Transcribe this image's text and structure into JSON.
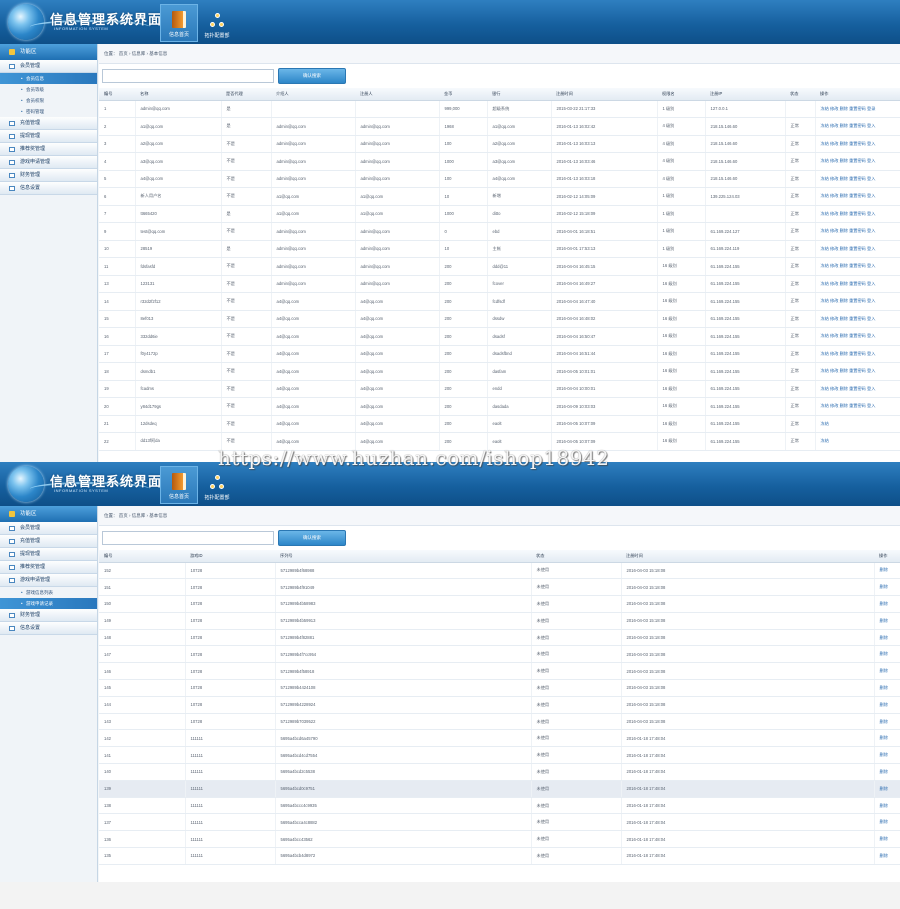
{
  "app": {
    "title": "信息管理系统界面",
    "subtitle": "INFORMATION SYSTEM"
  },
  "top_nav": [
    {
      "label": "信息首页",
      "icon": "book-icon"
    },
    {
      "label": "拓扑配置部"
    }
  ],
  "colors": {
    "header": "#16609f",
    "accent": "#2d86c8",
    "sidebar_active": "#3f95d6",
    "row_highlight": "#e6ebf2"
  },
  "panel1": {
    "sidebar": {
      "head": "功能区",
      "items": [
        {
          "type": "group",
          "label": "会员管理"
        },
        {
          "type": "sub",
          "label": "会员信息",
          "active": true
        },
        {
          "type": "sub",
          "label": "会员等级"
        },
        {
          "type": "sub",
          "label": "会员权限"
        },
        {
          "type": "sub",
          "label": "密码管理"
        },
        {
          "type": "group",
          "label": "充值管理"
        },
        {
          "type": "group",
          "label": "提现管理"
        },
        {
          "type": "group",
          "label": "推荐奖管理"
        },
        {
          "type": "group",
          "label": "游戏申请管理"
        },
        {
          "type": "group",
          "label": "财务管理"
        },
        {
          "type": "group",
          "label": "信息设置"
        }
      ]
    },
    "breadcrumb": "位置： 首页 › 信息库 › 基本信息",
    "search": {
      "placeholder": "",
      "button": "确认搜索"
    },
    "columns": [
      "编号",
      "名称",
      "是否代理",
      "介绍人",
      "注册人",
      "金币",
      "银行",
      "注册时间",
      "权限名",
      "注册IP",
      "状态",
      "操作"
    ],
    "col_widths": [
      36,
      86,
      50,
      84,
      84,
      48,
      64,
      106,
      48,
      80,
      30,
      90
    ],
    "rows": [
      [
        "1",
        "admin@qq.com",
        "是",
        "",
        "",
        "999,000",
        "超级系统",
        "2015-03-22 21:17:33",
        "1 级别",
        "127.0.0.1",
        "",
        "冻结 修改 删除 重置密码 登录"
      ],
      [
        "2",
        "a1@qq.com",
        "是",
        "admin@qq.com",
        "admin@qq.com",
        "1968",
        "a1@qq.com",
        "2016-01-13 16:02:42",
        "4 级别",
        "218.15.146.60",
        "正常",
        "冻结 修改 删除 重置密码 登入"
      ],
      [
        "3",
        "a2@qq.com",
        "不是",
        "admin@qq.com",
        "admin@qq.com",
        "100",
        "a2@qq.com",
        "2016-01-13 16:03:13",
        "4 级别",
        "218.15.146.60",
        "正常",
        "冻结 修改 删除 重置密码 登入"
      ],
      [
        "4",
        "a3@qq.com",
        "不是",
        "admin@qq.com",
        "admin@qq.com",
        "1000",
        "a3@qq.com",
        "2016-01-13 16:03:46",
        "4 级别",
        "218.15.146.60",
        "正常",
        "冻结 修改 删除 重置密码 登入"
      ],
      [
        "5",
        "a4@qq.com",
        "不是",
        "admin@qq.com",
        "admin@qq.com",
        "100",
        "a4@qq.com",
        "2016-01-13 16:03:18",
        "4 级别",
        "218.15.146.60",
        "正常",
        "冻结 修改 删除 重置密码 登入"
      ],
      [
        "6",
        "新人用户名",
        "不是",
        "a1@qq.com",
        "a1@qq.com",
        "10",
        "新增",
        "2016-02-12 14:05:09",
        "1 级别",
        "139.225.124.03",
        "正常",
        "冻结 修改 删除 重置密码 登入"
      ],
      [
        "7",
        "tt665420",
        "是",
        "a1@qq.com",
        "a1@qq.com",
        "1000",
        "ditto",
        "2016-02-12 15:18:09",
        "1 级别",
        "",
        "正常",
        "冻结 修改 删除 重置密码 登入"
      ],
      [
        "9",
        "test@qq.com",
        "不是",
        "admin@qq.com",
        "admin@qq.com",
        "0",
        "ebd",
        "2016-04-01 16:18:51",
        "1 级别",
        "61.169.224.127",
        "正常",
        "冻结 修改 删除 重置密码 登入"
      ],
      [
        "10",
        "28519",
        "是",
        "admin@qq.com",
        "admin@qq.com",
        "10",
        "主帐",
        "2016-04-01 17:53:13",
        "1 级别",
        "61.169.224.119",
        "正常",
        "冻结 修改 删除 重置密码 登入"
      ],
      [
        "11",
        "fdsfasfd",
        "不是",
        "admin@qq.com",
        "admin@qq.com",
        "200",
        "ddd@11",
        "2016-04-04 16:45:15",
        "16 级别",
        "61.169.224.155",
        "正常",
        "冻结 修改 删除 重置密码 登入"
      ],
      [
        "13",
        "123131",
        "不是",
        "admin@qq.com",
        "admin@qq.com",
        "200",
        "fcover",
        "2016-04-04 16:49:27",
        "16 级别",
        "61.169.224.155",
        "正常",
        "冻结 修改 删除 重置密码 登入"
      ],
      [
        "14",
        "r32d2f2f12",
        "不是",
        "a4@qq.com",
        "a4@qq.com",
        "200",
        "fcdfsdf",
        "2016-04-04 16:47:40",
        "16 级别",
        "61.169.224.155",
        "正常",
        "冻结 修改 删除 重置密码 登入"
      ],
      [
        "15",
        "8ef013",
        "不是",
        "a4@qq.com",
        "a4@qq.com",
        "200",
        "dssdw",
        "2016-04-04 16:48:02",
        "16 级别",
        "61.169.224.155",
        "正常",
        "冻结 修改 删除 重置密码 登入"
      ],
      [
        "16",
        "332dd6ie",
        "不是",
        "a4@qq.com",
        "a4@qq.com",
        "200",
        "dsadsf",
        "2016-04-04 16:50:47",
        "16 级别",
        "61.169.224.155",
        "正常",
        "冻结 修改 删除 重置密码 登入"
      ],
      [
        "17",
        "f0y4172p",
        "不是",
        "a4@qq.com",
        "a4@qq.com",
        "200",
        "dsadsfbnd",
        "2016-04-04 16:51:44",
        "16 级别",
        "61.169.224.155",
        "正常",
        "冻结 修改 删除 重置密码 登入"
      ],
      [
        "18",
        "dsmdb1",
        "不是",
        "a4@qq.com",
        "a4@qq.com",
        "200",
        "dasfam",
        "2016-04-05 10:01:01",
        "16 级别",
        "61.169.224.155",
        "正常",
        "冻结 修改 删除 重置密码 登入"
      ],
      [
        "19",
        "fcadms",
        "不是",
        "a4@qq.com",
        "a4@qq.com",
        "200",
        "endd",
        "2016-04-04 10:00:01",
        "16 级别",
        "61.169.224.155",
        "正常",
        "冻结 修改 删除 重置密码 登入"
      ],
      [
        "20",
        "y84d179gs",
        "不是",
        "a4@qq.com",
        "a4@qq.com",
        "200",
        "dasdada",
        "2016-04-09 10:03:03",
        "16 级别",
        "61.169.224.155",
        "正常",
        "冻结 修改 删除 重置密码 登入"
      ],
      [
        "21",
        "12dsdeq",
        "不是",
        "a4@qq.com",
        "a4@qq.com",
        "200",
        "eaolt",
        "2016-04-05 10:07:09",
        "16 级别",
        "61.169.224.155",
        "正常",
        "冻结"
      ],
      [
        "22",
        "dd13f阿da",
        "不是",
        "a4@qq.com",
        "a4@qq.com",
        "200",
        "eaolt",
        "2016-04-05 10:07:09",
        "16 级别",
        "61.169.224.155",
        "正常",
        "冻结"
      ]
    ]
  },
  "panel2": {
    "sidebar": {
      "head": "功能区",
      "items": [
        {
          "type": "group",
          "label": "会员管理"
        },
        {
          "type": "group",
          "label": "充值管理"
        },
        {
          "type": "group",
          "label": "提现管理"
        },
        {
          "type": "group",
          "label": "推荐奖管理"
        },
        {
          "type": "group",
          "label": "游戏申请管理"
        },
        {
          "type": "sub",
          "label": "游戏信息列表"
        },
        {
          "type": "sub",
          "label": "游戏申请记录",
          "active": true
        },
        {
          "type": "group",
          "label": "财务管理"
        },
        {
          "type": "group",
          "label": "信息设置"
        }
      ]
    },
    "breadcrumb": "位置： 首页 › 信息库 › 基本信息",
    "search": {
      "placeholder": "",
      "button": "确认搜索"
    },
    "columns": [
      "编号",
      "游戏ID",
      "序列号",
      "状态",
      "注册时间",
      "操作"
    ],
    "col_widths": [
      86,
      90,
      256,
      90,
      253,
      26
    ],
    "rows": [
      [
        "152",
        "10728",
        "5712989b4f68988",
        "未使用",
        "2016-04-03 15:18:08",
        "删除"
      ],
      [
        "151",
        "10728",
        "5712989b4f91049",
        "未使用",
        "2016-04-03 15:18:08",
        "删除"
      ],
      [
        "150",
        "10728",
        "5712989b4b58983",
        "未使用",
        "2016-04-03 15:18:08",
        "删除"
      ],
      [
        "149",
        "10728",
        "5712989b4b59913",
        "未使用",
        "2016-04-03 15:18:08",
        "删除"
      ],
      [
        "148",
        "10728",
        "5712989b4f82881",
        "未使用",
        "2016-04-03 15:18:08",
        "删除"
      ],
      [
        "147",
        "10728",
        "5712989b4f7cc954",
        "未使用",
        "2016-04-03 15:18:08",
        "删除"
      ],
      [
        "146",
        "10728",
        "5712989b4f58918",
        "未使用",
        "2016-04-03 15:18:08",
        "删除"
      ],
      [
        "145",
        "10728",
        "5712989b4424108",
        "未使用",
        "2016-04-03 15:18:08",
        "删除"
      ],
      [
        "144",
        "10728",
        "5712989b4228924",
        "未使用",
        "2016-04-03 15:18:08",
        "删除"
      ],
      [
        "143",
        "10728",
        "5712989b7039522",
        "未使用",
        "2016-04-03 15:18:08",
        "删除"
      ],
      [
        "142",
        "111111",
        "5695a4bcd6a45790",
        "未使用",
        "2016-01-18 17:48:04",
        "删除"
      ],
      [
        "141",
        "111111",
        "5695a4bcd4cd7554",
        "未使用",
        "2016-01-18 17:48:04",
        "删除"
      ],
      [
        "140",
        "111111",
        "5695a4bcd2c5538",
        "未使用",
        "2016-01-18 17:48:04",
        "删除"
      ],
      [
        "139",
        "111111",
        "5695a4bcd0c9751",
        "未使用",
        "2016-01-18 17:48:04",
        "删除"
      ],
      [
        "138",
        "111111",
        "5695a4bccc4c9935",
        "未使用",
        "2016-01-18 17:48:04",
        "删除"
      ],
      [
        "137",
        "111111",
        "5695a4bcca4c8882",
        "未使用",
        "2016-01-18 17:48:04",
        "删除"
      ],
      [
        "136",
        "111111",
        "5695a4bcc43562",
        "未使用",
        "2016-01-18 17:48:04",
        "删除"
      ],
      [
        "135",
        "111111",
        "5695a4bcb4d8972",
        "未使用",
        "2016-01-18 17:48:04",
        "删除"
      ]
    ],
    "highlight_row_index": 13
  },
  "watermark": "https://www.huzhan.com/ishop18942"
}
